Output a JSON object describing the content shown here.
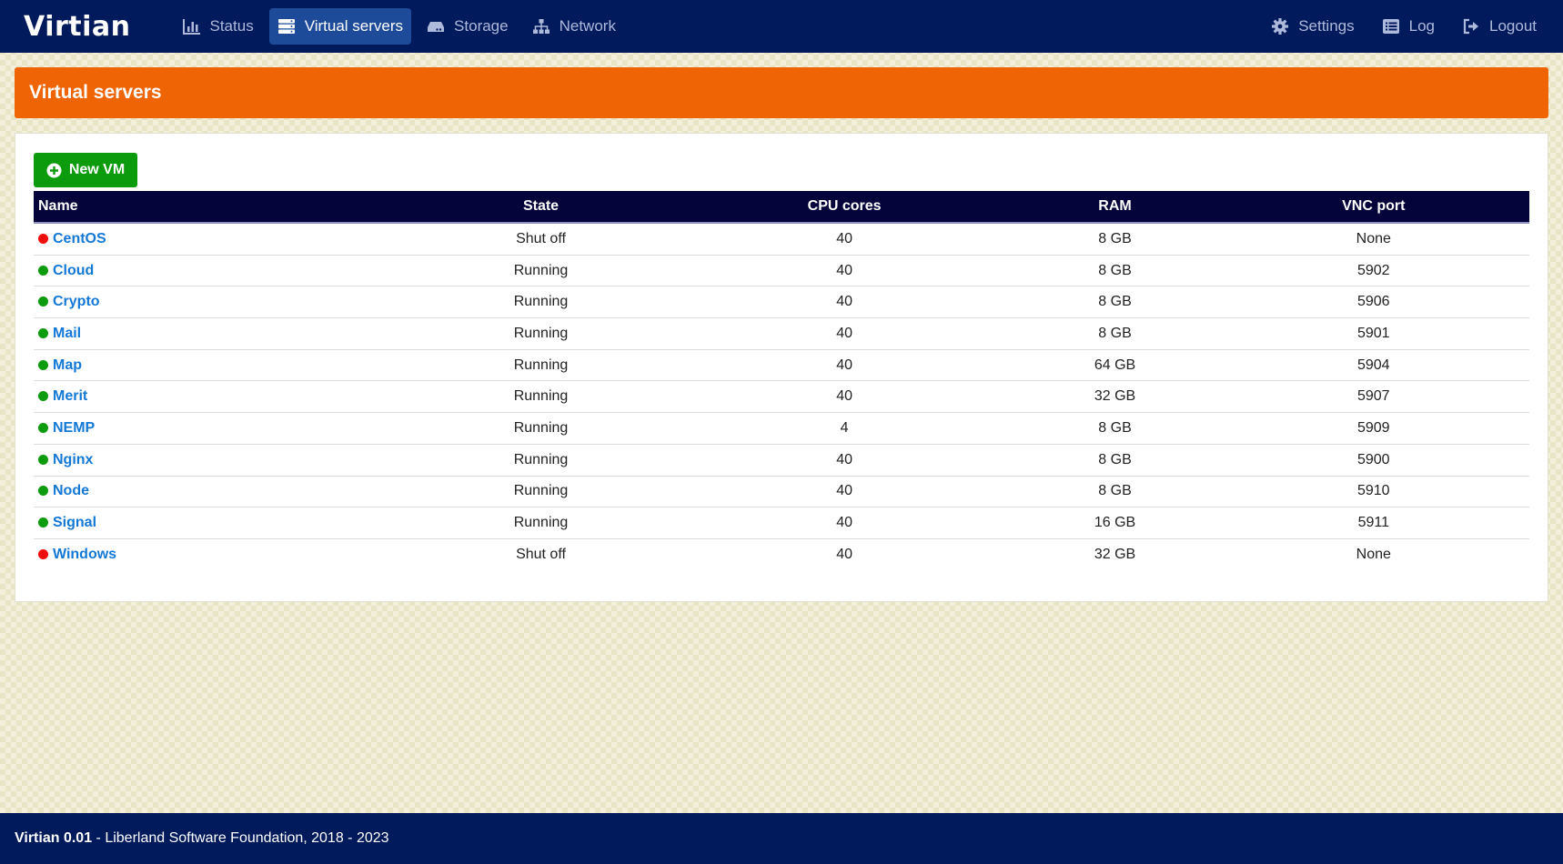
{
  "app": {
    "brand": "Virtian"
  },
  "nav": {
    "left": [
      {
        "label": "Status",
        "icon": "bar-chart-icon",
        "active": false
      },
      {
        "label": "Virtual servers",
        "icon": "server-icon",
        "active": true
      },
      {
        "label": "Storage",
        "icon": "hard-drive-icon",
        "active": false
      },
      {
        "label": "Network",
        "icon": "network-icon",
        "active": false
      }
    ],
    "right": [
      {
        "label": "Settings",
        "icon": "gear-icon"
      },
      {
        "label": "Log",
        "icon": "list-icon"
      },
      {
        "label": "Logout",
        "icon": "logout-icon"
      }
    ]
  },
  "page": {
    "title": "Virtual servers",
    "new_vm_label": "New VM"
  },
  "table": {
    "columns": [
      "Name",
      "State",
      "CPU cores",
      "RAM",
      "VNC port"
    ],
    "rows": [
      {
        "name": "CentOS",
        "status": "stopped",
        "state": "Shut off",
        "cpu": "40",
        "ram": "8 GB",
        "vnc": "None"
      },
      {
        "name": "Cloud",
        "status": "running",
        "state": "Running",
        "cpu": "40",
        "ram": "8 GB",
        "vnc": "5902"
      },
      {
        "name": "Crypto",
        "status": "running",
        "state": "Running",
        "cpu": "40",
        "ram": "8 GB",
        "vnc": "5906"
      },
      {
        "name": "Mail",
        "status": "running",
        "state": "Running",
        "cpu": "40",
        "ram": "8 GB",
        "vnc": "5901"
      },
      {
        "name": "Map",
        "status": "running",
        "state": "Running",
        "cpu": "40",
        "ram": "64 GB",
        "vnc": "5904"
      },
      {
        "name": "Merit",
        "status": "running",
        "state": "Running",
        "cpu": "40",
        "ram": "32 GB",
        "vnc": "5907"
      },
      {
        "name": "NEMP",
        "status": "running",
        "state": "Running",
        "cpu": "4",
        "ram": "8 GB",
        "vnc": "5909"
      },
      {
        "name": "Nginx",
        "status": "running",
        "state": "Running",
        "cpu": "40",
        "ram": "8 GB",
        "vnc": "5900"
      },
      {
        "name": "Node",
        "status": "running",
        "state": "Running",
        "cpu": "40",
        "ram": "8 GB",
        "vnc": "5910"
      },
      {
        "name": "Signal",
        "status": "running",
        "state": "Running",
        "cpu": "40",
        "ram": "16 GB",
        "vnc": "5911"
      },
      {
        "name": "Windows",
        "status": "stopped",
        "state": "Shut off",
        "cpu": "40",
        "ram": "32 GB",
        "vnc": "None"
      }
    ]
  },
  "footer": {
    "version": "Virtian 0.01",
    "text": " - Liberland Software Foundation, 2018 - 2023"
  },
  "colors": {
    "nav_bg": "#011a5c",
    "accent_orange": "#ef6404",
    "new_button_green": "#0c9b0c",
    "running_dot": "#0c9b0c",
    "stopped_dot": "#f20d0d",
    "link_blue": "#1378d6"
  }
}
